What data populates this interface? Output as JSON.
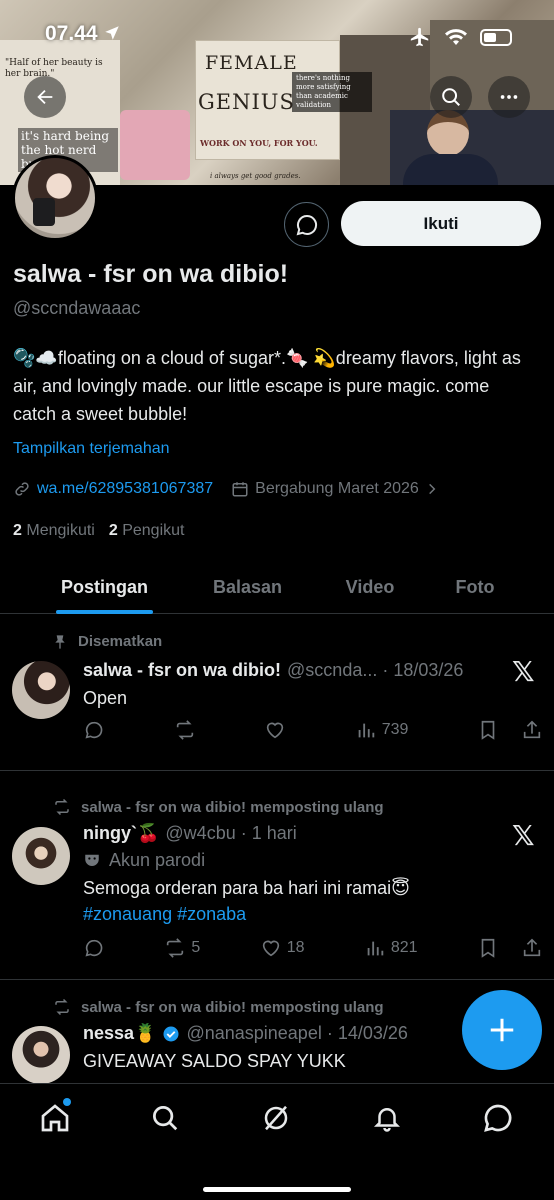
{
  "status_bar": {
    "time": "07.44"
  },
  "banner": {
    "female": "FEMALE",
    "genius": "GENIUS",
    "work": "WORK ON YOU, FOR YOU.",
    "half": "\"Half of her beauty is her brain.\"",
    "hard": "it's hard being the hot nerd but som",
    "there": "there's nothing more satisfying than academic validation",
    "always": "i always get good grades."
  },
  "profile": {
    "name": "salwa - fsr on wa dibio!",
    "handle": "@sccndawaaac",
    "bio": "🫧☁️floating on a cloud of sugar*.🍬 💫dreamy flavors, light as air, and lovingly made. our little escape is pure magic. come catch a sweet bubble!",
    "translate": "Tampilkan terjemahan",
    "link": "wa.me/62895381067387",
    "joined": "Bergabung Maret 2026",
    "following_count": "2",
    "following_label": "Mengikuti",
    "followers_count": "2",
    "followers_label": "Pengikut",
    "follow_button": "Ikuti"
  },
  "tabs": [
    {
      "label": "Postingan",
      "active": true
    },
    {
      "label": "Balasan"
    },
    {
      "label": "Video"
    },
    {
      "label": "Foto"
    }
  ],
  "posts": [
    {
      "context": "Disematkan",
      "name": "salwa - fsr on wa dibio!",
      "handle_time": "@sccnda... · 18/03/26",
      "text": "Open",
      "views": "739"
    },
    {
      "context": "salwa - fsr on wa dibio! memposting ulang",
      "name": "ningy`🍒",
      "handle_time": "@w4cbu · 1 hari",
      "label": "Akun parodi",
      "text": "Semoga orderan para ba hari ini ramai😇",
      "hashtags": "#zonauang #zonaba",
      "reposts": "5",
      "likes": "18",
      "views": "821"
    },
    {
      "context": "salwa - fsr on wa dibio! memposting ulang",
      "name": "nessa🍍",
      "handle_time": "@nanaspineapel · 14/03/26",
      "text": "GIVEAWAY SALDO SPAY YUKK"
    }
  ],
  "colors": {
    "accent": "#1d9bf0",
    "muted": "#71767b",
    "divider": "#2f3336"
  }
}
